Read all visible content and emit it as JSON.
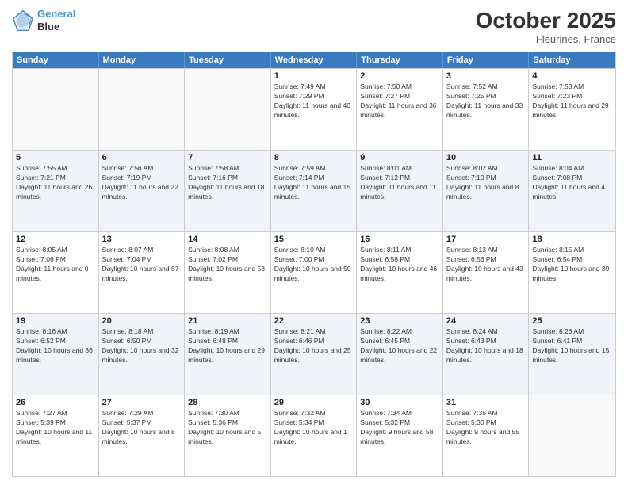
{
  "logo": {
    "line1": "General",
    "line2": "Blue"
  },
  "header": {
    "month": "October 2025",
    "location": "Fleurines, France"
  },
  "days_of_week": [
    "Sunday",
    "Monday",
    "Tuesday",
    "Wednesday",
    "Thursday",
    "Friday",
    "Saturday"
  ],
  "rows": [
    {
      "cells": [
        {
          "day": "",
          "sunrise": "",
          "sunset": "",
          "daylight": ""
        },
        {
          "day": "",
          "sunrise": "",
          "sunset": "",
          "daylight": ""
        },
        {
          "day": "",
          "sunrise": "",
          "sunset": "",
          "daylight": ""
        },
        {
          "day": "1",
          "sunrise": "Sunrise: 7:49 AM",
          "sunset": "Sunset: 7:29 PM",
          "daylight": "Daylight: 11 hours and 40 minutes."
        },
        {
          "day": "2",
          "sunrise": "Sunrise: 7:50 AM",
          "sunset": "Sunset: 7:27 PM",
          "daylight": "Daylight: 11 hours and 36 minutes."
        },
        {
          "day": "3",
          "sunrise": "Sunrise: 7:52 AM",
          "sunset": "Sunset: 7:25 PM",
          "daylight": "Daylight: 11 hours and 33 minutes."
        },
        {
          "day": "4",
          "sunrise": "Sunrise: 7:53 AM",
          "sunset": "Sunset: 7:23 PM",
          "daylight": "Daylight: 11 hours and 29 minutes."
        }
      ]
    },
    {
      "cells": [
        {
          "day": "5",
          "sunrise": "Sunrise: 7:55 AM",
          "sunset": "Sunset: 7:21 PM",
          "daylight": "Daylight: 11 hours and 26 minutes."
        },
        {
          "day": "6",
          "sunrise": "Sunrise: 7:56 AM",
          "sunset": "Sunset: 7:19 PM",
          "daylight": "Daylight: 11 hours and 22 minutes."
        },
        {
          "day": "7",
          "sunrise": "Sunrise: 7:58 AM",
          "sunset": "Sunset: 7:16 PM",
          "daylight": "Daylight: 11 hours and 18 minutes."
        },
        {
          "day": "8",
          "sunrise": "Sunrise: 7:59 AM",
          "sunset": "Sunset: 7:14 PM",
          "daylight": "Daylight: 11 hours and 15 minutes."
        },
        {
          "day": "9",
          "sunrise": "Sunrise: 8:01 AM",
          "sunset": "Sunset: 7:12 PM",
          "daylight": "Daylight: 11 hours and 11 minutes."
        },
        {
          "day": "10",
          "sunrise": "Sunrise: 8:02 AM",
          "sunset": "Sunset: 7:10 PM",
          "daylight": "Daylight: 11 hours and 8 minutes."
        },
        {
          "day": "11",
          "sunrise": "Sunrise: 8:04 AM",
          "sunset": "Sunset: 7:08 PM",
          "daylight": "Daylight: 11 hours and 4 minutes."
        }
      ]
    },
    {
      "cells": [
        {
          "day": "12",
          "sunrise": "Sunrise: 8:05 AM",
          "sunset": "Sunset: 7:06 PM",
          "daylight": "Daylight: 11 hours and 0 minutes."
        },
        {
          "day": "13",
          "sunrise": "Sunrise: 8:07 AM",
          "sunset": "Sunset: 7:04 PM",
          "daylight": "Daylight: 10 hours and 57 minutes."
        },
        {
          "day": "14",
          "sunrise": "Sunrise: 8:08 AM",
          "sunset": "Sunset: 7:02 PM",
          "daylight": "Daylight: 10 hours and 53 minutes."
        },
        {
          "day": "15",
          "sunrise": "Sunrise: 8:10 AM",
          "sunset": "Sunset: 7:00 PM",
          "daylight": "Daylight: 10 hours and 50 minutes."
        },
        {
          "day": "16",
          "sunrise": "Sunrise: 8:11 AM",
          "sunset": "Sunset: 6:58 PM",
          "daylight": "Daylight: 10 hours and 46 minutes."
        },
        {
          "day": "17",
          "sunrise": "Sunrise: 8:13 AM",
          "sunset": "Sunset: 6:56 PM",
          "daylight": "Daylight: 10 hours and 43 minutes."
        },
        {
          "day": "18",
          "sunrise": "Sunrise: 8:15 AM",
          "sunset": "Sunset: 6:54 PM",
          "daylight": "Daylight: 10 hours and 39 minutes."
        }
      ]
    },
    {
      "cells": [
        {
          "day": "19",
          "sunrise": "Sunrise: 8:16 AM",
          "sunset": "Sunset: 6:52 PM",
          "daylight": "Daylight: 10 hours and 36 minutes."
        },
        {
          "day": "20",
          "sunrise": "Sunrise: 8:18 AM",
          "sunset": "Sunset: 6:50 PM",
          "daylight": "Daylight: 10 hours and 32 minutes."
        },
        {
          "day": "21",
          "sunrise": "Sunrise: 8:19 AM",
          "sunset": "Sunset: 6:48 PM",
          "daylight": "Daylight: 10 hours and 29 minutes."
        },
        {
          "day": "22",
          "sunrise": "Sunrise: 8:21 AM",
          "sunset": "Sunset: 6:46 PM",
          "daylight": "Daylight: 10 hours and 25 minutes."
        },
        {
          "day": "23",
          "sunrise": "Sunrise: 8:22 AM",
          "sunset": "Sunset: 6:45 PM",
          "daylight": "Daylight: 10 hours and 22 minutes."
        },
        {
          "day": "24",
          "sunrise": "Sunrise: 8:24 AM",
          "sunset": "Sunset: 6:43 PM",
          "daylight": "Daylight: 10 hours and 18 minutes."
        },
        {
          "day": "25",
          "sunrise": "Sunrise: 8:26 AM",
          "sunset": "Sunset: 6:41 PM",
          "daylight": "Daylight: 10 hours and 15 minutes."
        }
      ]
    },
    {
      "cells": [
        {
          "day": "26",
          "sunrise": "Sunrise: 7:27 AM",
          "sunset": "Sunset: 5:39 PM",
          "daylight": "Daylight: 10 hours and 11 minutes."
        },
        {
          "day": "27",
          "sunrise": "Sunrise: 7:29 AM",
          "sunset": "Sunset: 5:37 PM",
          "daylight": "Daylight: 10 hours and 8 minutes."
        },
        {
          "day": "28",
          "sunrise": "Sunrise: 7:30 AM",
          "sunset": "Sunset: 5:36 PM",
          "daylight": "Daylight: 10 hours and 5 minutes."
        },
        {
          "day": "29",
          "sunrise": "Sunrise: 7:32 AM",
          "sunset": "Sunset: 5:34 PM",
          "daylight": "Daylight: 10 hours and 1 minute."
        },
        {
          "day": "30",
          "sunrise": "Sunrise: 7:34 AM",
          "sunset": "Sunset: 5:32 PM",
          "daylight": "Daylight: 9 hours and 58 minutes."
        },
        {
          "day": "31",
          "sunrise": "Sunrise: 7:35 AM",
          "sunset": "Sunset: 5:30 PM",
          "daylight": "Daylight: 9 hours and 55 minutes."
        },
        {
          "day": "",
          "sunrise": "",
          "sunset": "",
          "daylight": ""
        }
      ]
    }
  ]
}
